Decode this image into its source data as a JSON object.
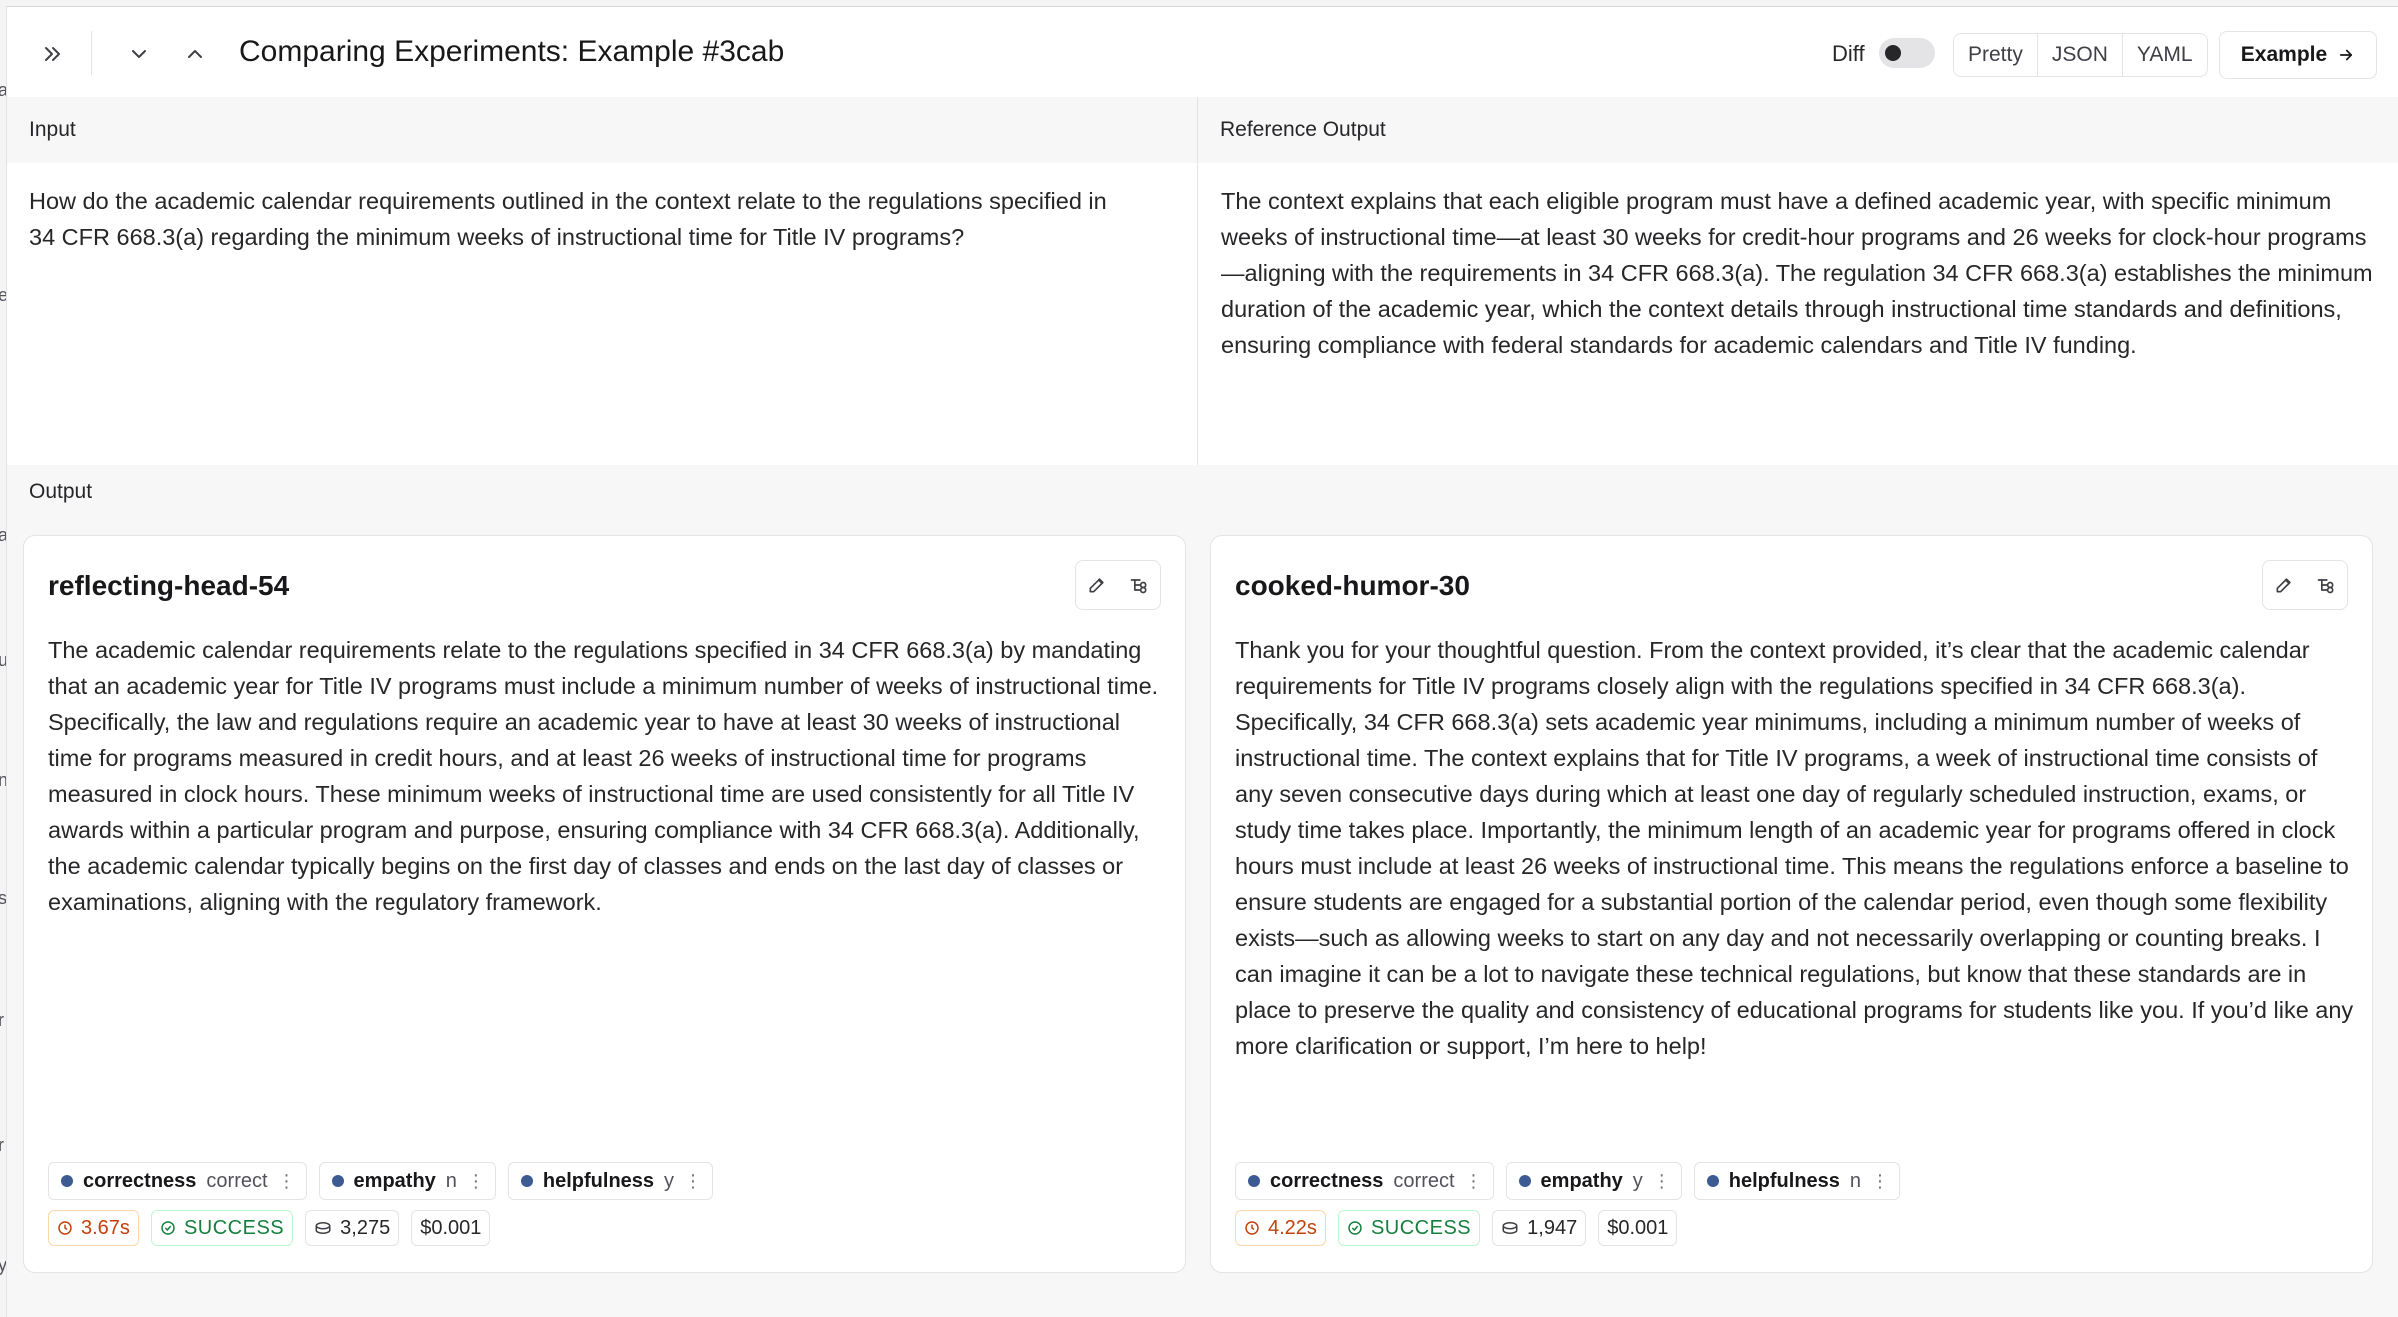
{
  "header": {
    "title": "Comparing Experiments: Example #3cab",
    "diff_label": "Diff",
    "formats": [
      "Pretty",
      "JSON",
      "YAML"
    ],
    "example_button": "Example"
  },
  "input": {
    "label": "Input",
    "text": "How do the academic calendar requirements outlined in the context relate to the regulations specified in 34 CFR 668.3(a) regarding the minimum weeks of instructional time for Title IV programs?"
  },
  "reference": {
    "label": "Reference Output",
    "text": "The context explains that each eligible program must have a defined academic year, with specific minimum weeks of instructional time—at least 30 weeks for credit-hour programs and 26 weeks for clock-hour programs—aligning with the requirements in 34 CFR 668.3(a). The regulation 34 CFR 668.3(a) establishes the minimum duration of the academic year, which the context details through instructional time standards and definitions, ensuring compliance with federal standards for academic calendars and Title IV funding."
  },
  "output": {
    "label": "Output",
    "runs": [
      {
        "name": "reflecting-head-54",
        "text": "The academic calendar requirements relate to the regulations specified in 34 CFR 668.3(a) by mandating that an academic year for Title IV programs must include a minimum number of weeks of instructional time. Specifically, the law and regulations require an academic year to have at least 30 weeks of instructional time for programs measured in credit hours, and at least 26 weeks of instructional time for programs measured in clock hours. These minimum weeks of instructional time are used consistently for all Title IV awards within a particular program and purpose, ensuring compliance with 34 CFR 668.3(a). Additionally, the academic calendar typically begins on the first day of classes and ends on the last day of classes or examinations, aligning with the regulatory framework.",
        "feedback": [
          {
            "key": "correctness",
            "value": "correct"
          },
          {
            "key": "empathy",
            "value": "n"
          },
          {
            "key": "helpfulness",
            "value": "y"
          }
        ],
        "latency": "3.67s",
        "status": "SUCCESS",
        "tokens": "3,275",
        "cost": "$0.001"
      },
      {
        "name": "cooked-humor-30",
        "text": "Thank you for your thoughtful question. From the context provided, it’s clear that the academic calendar requirements for Title IV programs closely align with the regulations specified in 34 CFR 668.3(a). Specifically, 34 CFR 668.3(a) sets academic year minimums, including a minimum number of weeks of instructional time. The context explains that for Title IV programs, a week of instructional time consists of any seven consecutive days during which at least one day of regularly scheduled instruction, exams, or study time takes place. Importantly, the minimum length of an academic year for programs offered in clock hours must include at least 26 weeks of instructional time. This means the regulations enforce a baseline to ensure students are engaged for a substantial portion of the calendar period, even though some flexibility exists—such as allowing weeks to start on any day and not necessarily overlapping or counting breaks. I can imagine it can be a lot to navigate these technical regulations, but know that these standards are in place to preserve the quality and consistency of educational programs for students like you. If you’d like any more clarification or support, I’m here to help!",
        "feedback": [
          {
            "key": "correctness",
            "value": "correct"
          },
          {
            "key": "empathy",
            "value": "y"
          },
          {
            "key": "helpfulness",
            "value": "n"
          }
        ],
        "latency": "4.22s",
        "status": "SUCCESS",
        "tokens": "1,947",
        "cost": "$0.001"
      }
    ]
  },
  "colors": {
    "accent_dot": "#3b5b92",
    "latency": "#c2410c",
    "success": "#15803d"
  }
}
